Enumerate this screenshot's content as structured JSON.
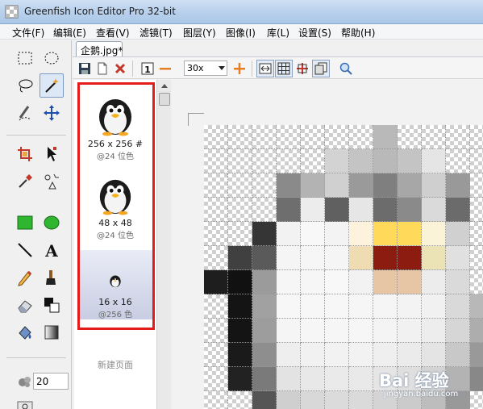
{
  "window": {
    "title": "Greenfish Icon Editor Pro 32-bit"
  },
  "menu": [
    "文件(F)",
    "编辑(E)",
    "查看(V)",
    "滤镜(T)",
    "图层(Y)",
    "图像(I)",
    "库(L)",
    "设置(S)",
    "帮助(H)"
  ],
  "tools": {
    "active": "magic-wand",
    "brush_size_value": "20"
  },
  "document": {
    "tab_label": "企鹅.jpg*"
  },
  "toolbar": {
    "zoom": "30x",
    "zoom_options": [
      "30x"
    ]
  },
  "pages": {
    "items": [
      {
        "size": "256 x 256 #",
        "depth": "@24 位色",
        "selected": false
      },
      {
        "size": "48 x 48",
        "depth": "@24 位色",
        "selected": false
      },
      {
        "size": "16 x 16",
        "depth": "@256 色",
        "selected": true
      }
    ],
    "new_page_label": "新建页面",
    "highlight_color": "#e41b1b"
  },
  "canvas": {
    "grid_color": "#9a9a9a",
    "pixels": [
      [
        "t",
        "t",
        "t",
        "t",
        "t",
        "t",
        "t",
        "#b9b9b9",
        "t",
        "t",
        "t",
        "t"
      ],
      [
        "t",
        "t",
        "t",
        "t",
        "t",
        "#d3d3d3",
        "#c4c4c4",
        "#b9b9b9",
        "#c4c4c4",
        "#e5e5e5",
        "t",
        "t"
      ],
      [
        "t",
        "t",
        "t",
        "#8a8a8a",
        "#b3b3b3",
        "#d0d0d0",
        "#9a9a9a",
        "#7f7f7f",
        "#a7a7a7",
        "#cfcfcf",
        "#999999",
        "t"
      ],
      [
        "t",
        "t",
        "t",
        "#6e6e6e",
        "#ececec",
        "#606060",
        "#e6e6e6",
        "#6c6c6c",
        "#8a8a8a",
        "#dadada",
        "#6b6b6b",
        "t"
      ],
      [
        "t",
        "t",
        "#353535",
        "#f2f2f2",
        "#f8f8f8",
        "#f3f3f3",
        "#fdf3dc",
        "#ffd95a",
        "#ffd95a",
        "#fbf3d8",
        "#d0d0d0",
        "t"
      ],
      [
        "t",
        "#404040",
        "#5a5a5a",
        "#f5f5f5",
        "#f6f6f6",
        "#f5f5f5",
        "#efdcb2",
        "#8c1b10",
        "#8c1b10",
        "#ebe2b6",
        "#e0e0e0",
        "t"
      ],
      [
        "#1e1e1e",
        "#111111",
        "#9b9b9b",
        "#f6f6f6",
        "#f6f6f6",
        "#f8f8f8",
        "#f2f2f2",
        "#e7c6a5",
        "#e7c6a5",
        "#ececec",
        "#dadada",
        "t"
      ],
      [
        "t",
        "#141414",
        "#a1a1a1",
        "#f7f7f7",
        "#f7f7f7",
        "#f7f7f7",
        "#f6f6f6",
        "#f5f5f5",
        "#f3f3f3",
        "#f1f1f1",
        "#d9d9d9",
        "#b8b8b8"
      ],
      [
        "t",
        "#141414",
        "#9d9d9d",
        "#f5f5f5",
        "#f6f6f6",
        "#f6f6f6",
        "#f6f6f6",
        "#f4f4f4",
        "#f1f1f1",
        "#ededed",
        "#d6d6d6",
        "#adadad"
      ],
      [
        "t",
        "#1a1a1a",
        "#8e8e8e",
        "#eeeeee",
        "#f1f1f1",
        "#f2f2f2",
        "#f2f2f2",
        "#efefef",
        "#ebebeb",
        "#e4e4e4",
        "#c8c8c8",
        "#999999"
      ],
      [
        "t",
        "#222222",
        "#7a7a7a",
        "#e3e3e3",
        "#e8e8e8",
        "#eaeaea",
        "#e9e9e9",
        "#e5e5e5",
        "#dfdfdf",
        "#d3d3d3",
        "#b3b3b3",
        "#888888"
      ],
      [
        "t",
        "t",
        "#555555",
        "#cfcfcf",
        "#d8d8d8",
        "#dbdbdb",
        "#dadada",
        "#d4d4d4",
        "#cbcbcb",
        "#bdbdbd",
        "#999999",
        "t"
      ]
    ]
  },
  "watermark": {
    "brand": "Bai 经验",
    "url": "jingyan.baidu.com"
  }
}
